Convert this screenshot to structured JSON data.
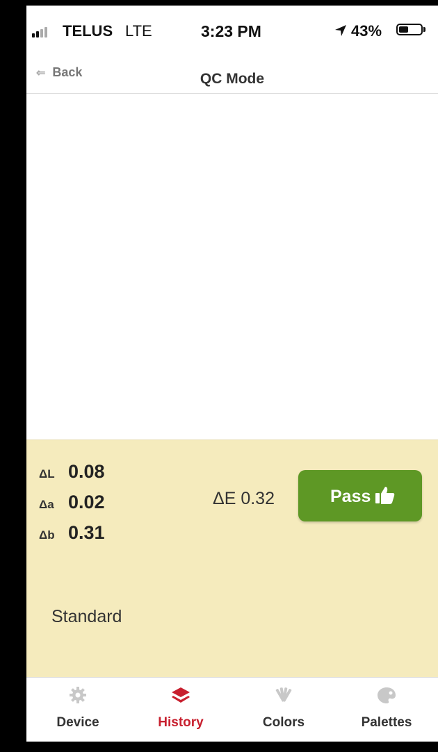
{
  "status_bar": {
    "carrier": "TELUS",
    "network": "LTE",
    "time": "3:23 PM",
    "battery_percent": "43%",
    "battery_level": 0.43
  },
  "nav": {
    "back_label": "Back",
    "title": "QC Mode"
  },
  "results": {
    "delta_L": {
      "symbol": "ΔL",
      "value": "0.08"
    },
    "delta_a": {
      "symbol": "Δa",
      "value": "0.02"
    },
    "delta_b": {
      "symbol": "Δb",
      "value": "0.31"
    },
    "delta_E": "ΔE 0.32",
    "status_label": "Pass",
    "status_color": "#5e9825"
  },
  "standard": {
    "label": "Standard",
    "background": "#f5ebbd"
  },
  "tabs": [
    {
      "label": "Device",
      "icon": "gear-icon",
      "active": false
    },
    {
      "label": "History",
      "icon": "layers-icon",
      "active": true
    },
    {
      "label": "Colors",
      "icon": "fan-deck-icon",
      "active": false
    },
    {
      "label": "Palettes",
      "icon": "palette-icon",
      "active": false
    }
  ],
  "colors": {
    "accent": "#c8202f",
    "inactive_icon": "#c8c8c8"
  }
}
